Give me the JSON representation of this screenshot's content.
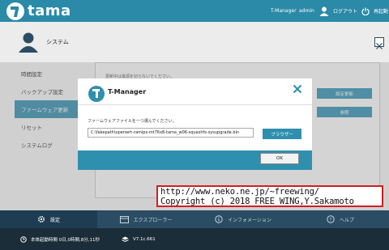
{
  "topbar": {
    "logo_text": "tama",
    "app_name": "T-Manager",
    "user": "admin",
    "logout_label": "ログアウト",
    "power_label": "再起動"
  },
  "page": {
    "title": "システム"
  },
  "sidebar": {
    "items": [
      {
        "label": "時間設定"
      },
      {
        "label": "バックアップ設定"
      },
      {
        "label": "ファームウェア更新",
        "active": true
      },
      {
        "label": "リセット"
      },
      {
        "label": "システムログ"
      }
    ]
  },
  "panel": {
    "note": "更新中は電源を切らないでください。",
    "update_button": "設定更新",
    "reference_button": "参照"
  },
  "modal": {
    "title": "T-Manager",
    "instruction": "ファームウェアファイルを一つ選んでください。",
    "file_value": "C:\\fakepath\\openwrt-ramips-mt76x8-tama_w06-squashfs-sysupgrade.bin",
    "browse_label": "ブラウザー",
    "ok_label": "OK"
  },
  "watermark": {
    "line1": "http://www.neko.ne.jp/~freewing/",
    "line2": "Copyright (c) 2018 FREE WING,Y.Sakamoto"
  },
  "bottom_nav": {
    "items": [
      {
        "label": "設定",
        "icon": "gear-icon",
        "active": true
      },
      {
        "label": "エクスプローラー",
        "icon": "folder-icon"
      },
      {
        "label": "インフォメーション",
        "icon": "info-icon"
      },
      {
        "label": "ヘルプ",
        "icon": "help-icon"
      }
    ]
  },
  "status": {
    "uptime": "本体起動時間  0日,0時間,8分,11秒",
    "version": "V7.1c.661"
  },
  "colors": {
    "accent": "#2f8fae",
    "topbar": "#2a8aa8",
    "nav": "#2a4d63",
    "statusbar": "#1b2d38",
    "watermark_border": "#d21f1f"
  }
}
